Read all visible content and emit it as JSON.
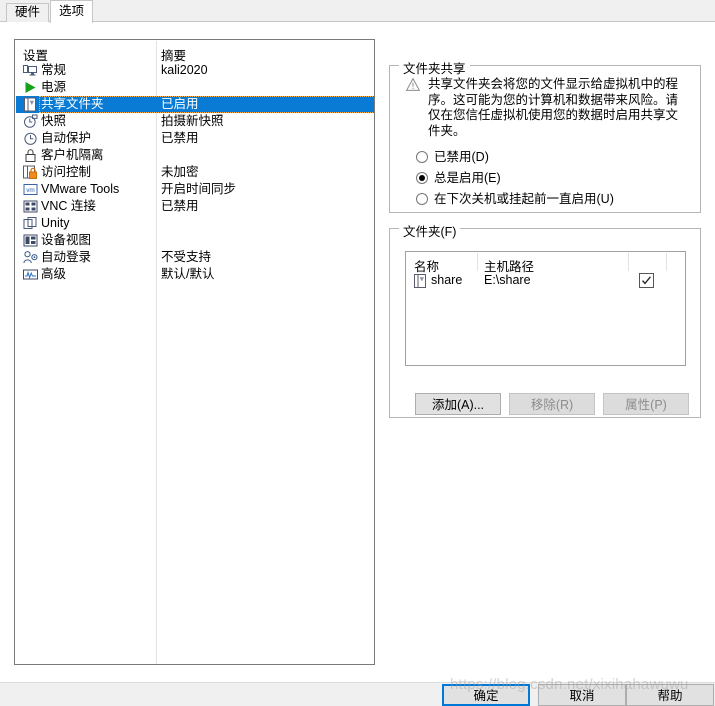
{
  "tabs": [
    {
      "label": "硬件",
      "selected": false
    },
    {
      "label": "选项",
      "selected": true
    }
  ],
  "settings_list": {
    "columns": [
      "设置",
      "摘要"
    ],
    "rows": [
      {
        "icon": "monitor-icon",
        "name": "常规",
        "summary": "kali2020",
        "selected": false
      },
      {
        "icon": "power-icon",
        "name": "电源",
        "summary": "",
        "selected": false
      },
      {
        "icon": "shared-folder-icon",
        "name": "共享文件夹",
        "summary": "已启用",
        "selected": true
      },
      {
        "icon": "snapshot-icon",
        "name": "快照",
        "summary": "拍摄新快照",
        "selected": false
      },
      {
        "icon": "autoprotect-icon",
        "name": "自动保护",
        "summary": "已禁用",
        "selected": false
      },
      {
        "icon": "guest-isolation-icon",
        "name": "客户机隔离",
        "summary": "",
        "selected": false
      },
      {
        "icon": "access-control-icon",
        "name": "访问控制",
        "summary": "未加密",
        "selected": false
      },
      {
        "icon": "vmware-tools-icon",
        "name": "VMware Tools",
        "summary": "开启时间同步",
        "selected": false
      },
      {
        "icon": "vnc-icon",
        "name": "VNC 连接",
        "summary": "已禁用",
        "selected": false
      },
      {
        "icon": "unity-icon",
        "name": "Unity",
        "summary": "",
        "selected": false
      },
      {
        "icon": "device-view-icon",
        "name": "设备视图",
        "summary": "",
        "selected": false
      },
      {
        "icon": "autologin-icon",
        "name": "自动登录",
        "summary": "不受支持",
        "selected": false
      },
      {
        "icon": "advanced-icon",
        "name": "高级",
        "summary": "默认/默认",
        "selected": false
      }
    ]
  },
  "folder_sharing": {
    "group_label": "文件夹共享",
    "warning_icon": "warning-triangle-icon",
    "warning_text": "共享文件夹会将您的文件显示给虚拟机中的程序。这可能为您的计算机和数据带来风险。请仅在您信任虚拟机使用您的数据时启用共享文件夹。",
    "options": [
      {
        "label": "已禁用(D)",
        "selected": false
      },
      {
        "label": "总是启用(E)",
        "selected": true
      },
      {
        "label": "在下次关机或挂起前一直启用(U)",
        "selected": false
      }
    ]
  },
  "folders": {
    "group_label": "文件夹(F)",
    "columns": [
      "名称",
      "主机路径"
    ],
    "rows": [
      {
        "icon": "folder-icon",
        "name": "share",
        "host_path": "E:\\share",
        "enabled": true
      }
    ],
    "buttons": [
      {
        "label": "添加(A)...",
        "enabled": true
      },
      {
        "label": "移除(R)",
        "enabled": false
      },
      {
        "label": "属性(P)",
        "enabled": false
      }
    ]
  },
  "footer": {
    "ok_label": "确定",
    "cancel_label": "取消",
    "help_label": "帮助"
  },
  "watermark": "https://blog.csdn.net/xixihahawuwu",
  "colors": {
    "selection_blue": "#0a7bd5",
    "focus_blue": "#0078d7",
    "window_bg": "#ffffff",
    "panel_bg": "#f0f0f0"
  }
}
